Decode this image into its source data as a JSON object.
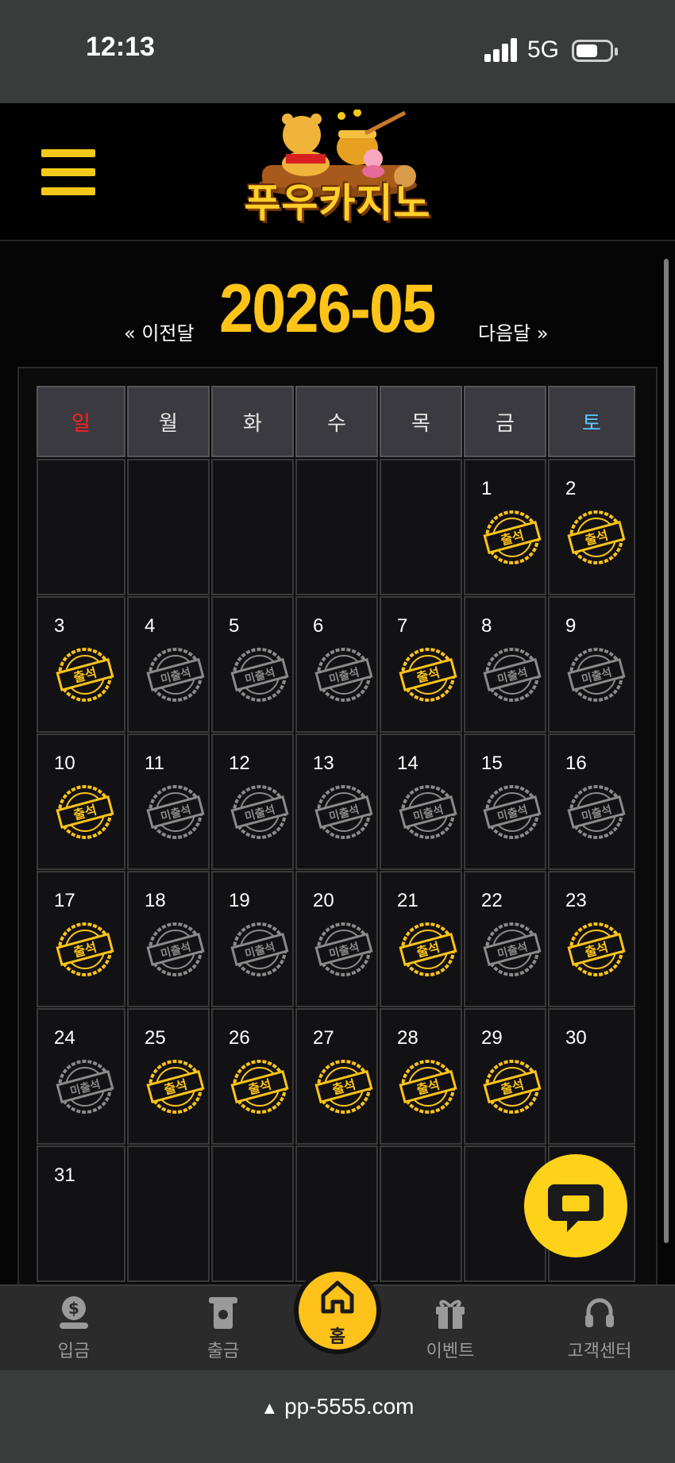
{
  "status": {
    "time": "12:13",
    "network": "5G"
  },
  "header": {
    "logo_text": "푸우카지노"
  },
  "month_nav": {
    "prev_label": "« 이전달",
    "title": "2026-05",
    "next_label": "다음달 »"
  },
  "calendar": {
    "weekdays": [
      "일",
      "월",
      "화",
      "수",
      "목",
      "금",
      "토"
    ],
    "stamp_attended": "출석",
    "stamp_absent": "미출석",
    "weeks": [
      [
        {
          "d": ""
        },
        {
          "d": ""
        },
        {
          "d": ""
        },
        {
          "d": ""
        },
        {
          "d": ""
        },
        {
          "d": "1",
          "s": "att"
        },
        {
          "d": "2",
          "s": "att"
        }
      ],
      [
        {
          "d": "3",
          "s": "att"
        },
        {
          "d": "4",
          "s": "abs"
        },
        {
          "d": "5",
          "s": "abs"
        },
        {
          "d": "6",
          "s": "abs"
        },
        {
          "d": "7",
          "s": "att"
        },
        {
          "d": "8",
          "s": "abs"
        },
        {
          "d": "9",
          "s": "abs"
        }
      ],
      [
        {
          "d": "10",
          "s": "att"
        },
        {
          "d": "11",
          "s": "abs"
        },
        {
          "d": "12",
          "s": "abs"
        },
        {
          "d": "13",
          "s": "abs"
        },
        {
          "d": "14",
          "s": "abs"
        },
        {
          "d": "15",
          "s": "abs"
        },
        {
          "d": "16",
          "s": "abs"
        }
      ],
      [
        {
          "d": "17",
          "s": "att"
        },
        {
          "d": "18",
          "s": "abs"
        },
        {
          "d": "19",
          "s": "abs"
        },
        {
          "d": "20",
          "s": "abs"
        },
        {
          "d": "21",
          "s": "att"
        },
        {
          "d": "22",
          "s": "abs"
        },
        {
          "d": "23",
          "s": "att"
        }
      ],
      [
        {
          "d": "24",
          "s": "abs"
        },
        {
          "d": "25",
          "s": "att"
        },
        {
          "d": "26",
          "s": "att"
        },
        {
          "d": "27",
          "s": "att"
        },
        {
          "d": "28",
          "s": "att"
        },
        {
          "d": "29",
          "s": "att"
        },
        {
          "d": "30"
        }
      ],
      [
        {
          "d": "31"
        },
        {
          "d": ""
        },
        {
          "d": ""
        },
        {
          "d": ""
        },
        {
          "d": ""
        },
        {
          "d": ""
        },
        {
          "d": ""
        }
      ]
    ]
  },
  "bottom_nav": {
    "items": [
      {
        "label": "입금",
        "icon": "deposit-icon"
      },
      {
        "label": "출금",
        "icon": "withdraw-icon"
      },
      {
        "label": "홈",
        "icon": "home-icon"
      },
      {
        "label": "이벤트",
        "icon": "gift-icon"
      },
      {
        "label": "고객센터",
        "icon": "headset-icon"
      }
    ]
  },
  "browser": {
    "url": "pp-5555.com"
  },
  "colors": {
    "accent": "#ffc417",
    "sunday": "#ff1f1f",
    "saturday": "#58c8ff",
    "absent_stamp": "#8a8a8a"
  }
}
